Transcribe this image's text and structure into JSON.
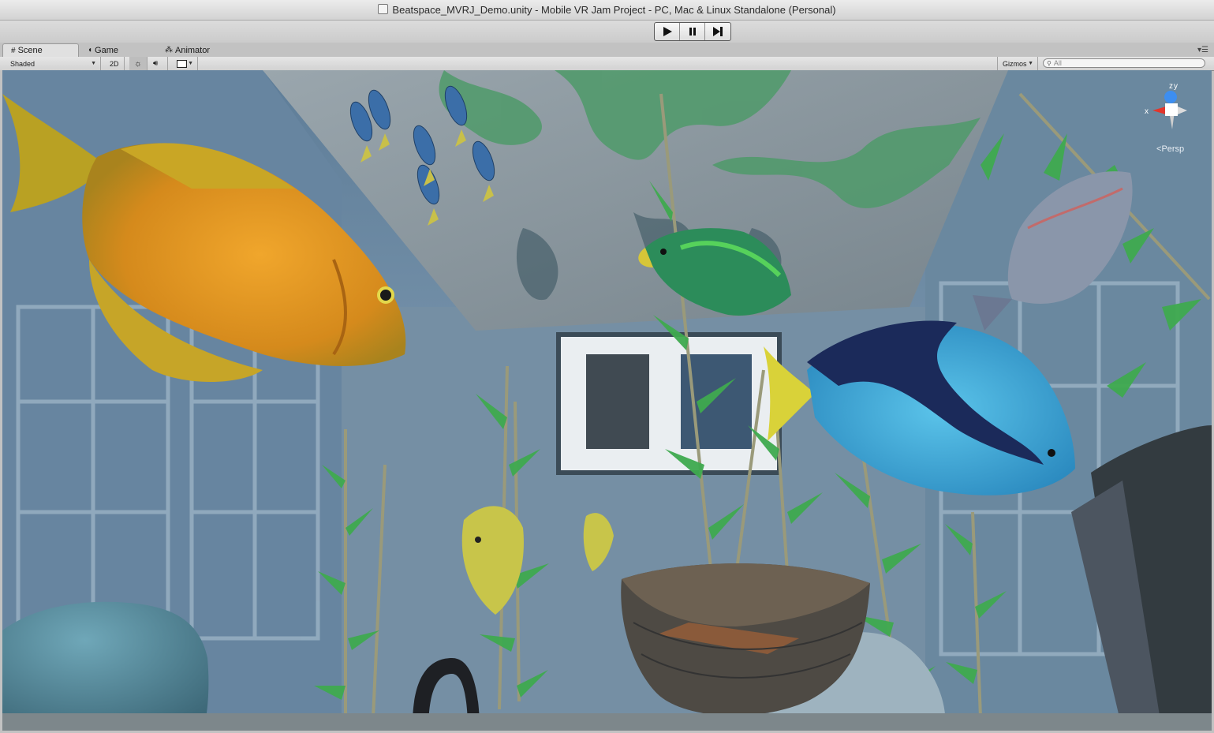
{
  "window": {
    "title": "Beatspace_MVRJ_Demo.unity - Mobile VR Jam Project - PC, Mac & Linux Standalone (Personal)"
  },
  "playbar": {
    "buttons": [
      {
        "name": "play",
        "icon": "play-icon"
      },
      {
        "name": "pause",
        "icon": "pause-icon"
      },
      {
        "name": "step",
        "icon": "step-icon"
      }
    ]
  },
  "tabs": [
    {
      "label": "Scene",
      "icon": "grid-icon",
      "active": true
    },
    {
      "label": "Game",
      "icon": "pacman-icon",
      "active": false
    },
    {
      "label": "Animator",
      "icon": "animator-icon",
      "active": false
    }
  ],
  "scene_toolbar": {
    "draw_mode": "Shaded",
    "mode_2d": "2D",
    "gizmos": "Gizmos",
    "search_placeholder": "All"
  },
  "scene_gizmo": {
    "axis_y": "y",
    "axis_z": "z",
    "axis_x": "x",
    "projection": "Persp"
  },
  "colors": {
    "x_axis": "#e2362c",
    "y_axis": "#9ee064",
    "z_axis": "#3d8ef0",
    "water": "#7a98b0"
  }
}
